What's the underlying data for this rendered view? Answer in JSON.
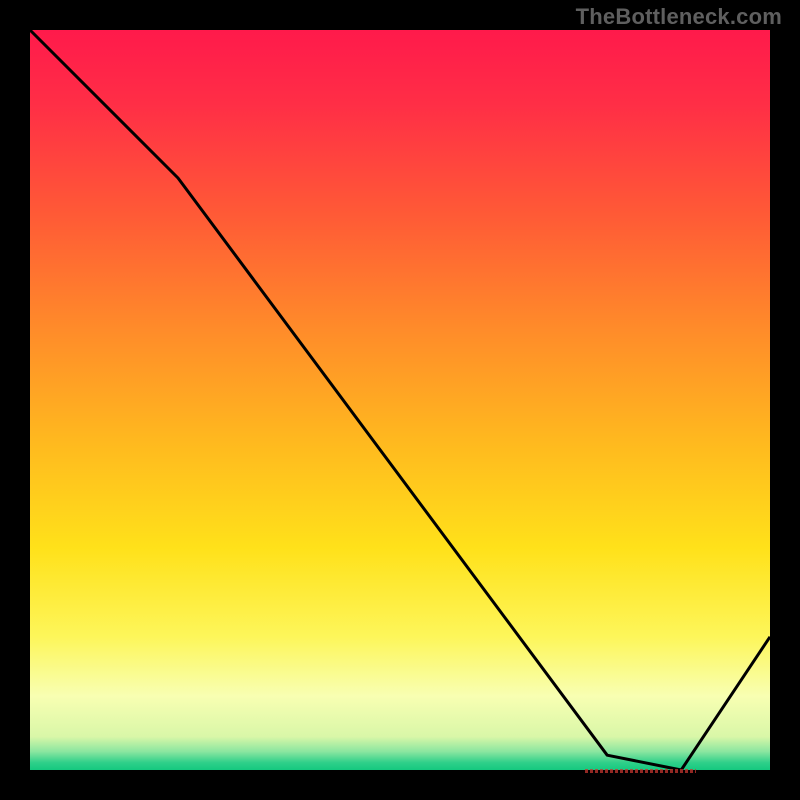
{
  "attribution": "TheBottleneck.com",
  "chart_data": {
    "type": "line",
    "title": "",
    "xlabel": "",
    "ylabel": "",
    "xlim": [
      0,
      100
    ],
    "ylim": [
      0,
      100
    ],
    "x": [
      0,
      20,
      78,
      88,
      100
    ],
    "y": [
      100,
      80,
      2,
      0,
      18
    ],
    "marker_label": "",
    "marker_at_x": 82,
    "axes_visible": false,
    "background_gradient": {
      "stops": [
        {
          "offset": 0.0,
          "color": "#ff1a4b"
        },
        {
          "offset": 0.1,
          "color": "#ff2e46"
        },
        {
          "offset": 0.25,
          "color": "#ff5a36"
        },
        {
          "offset": 0.4,
          "color": "#ff8a2a"
        },
        {
          "offset": 0.55,
          "color": "#ffb71f"
        },
        {
          "offset": 0.7,
          "color": "#ffe11a"
        },
        {
          "offset": 0.82,
          "color": "#fdf65a"
        },
        {
          "offset": 0.9,
          "color": "#f8ffb2"
        },
        {
          "offset": 0.955,
          "color": "#d9f7a8"
        },
        {
          "offset": 0.975,
          "color": "#8be6a0"
        },
        {
          "offset": 0.99,
          "color": "#2fd08a"
        },
        {
          "offset": 1.0,
          "color": "#15c97f"
        }
      ]
    }
  }
}
